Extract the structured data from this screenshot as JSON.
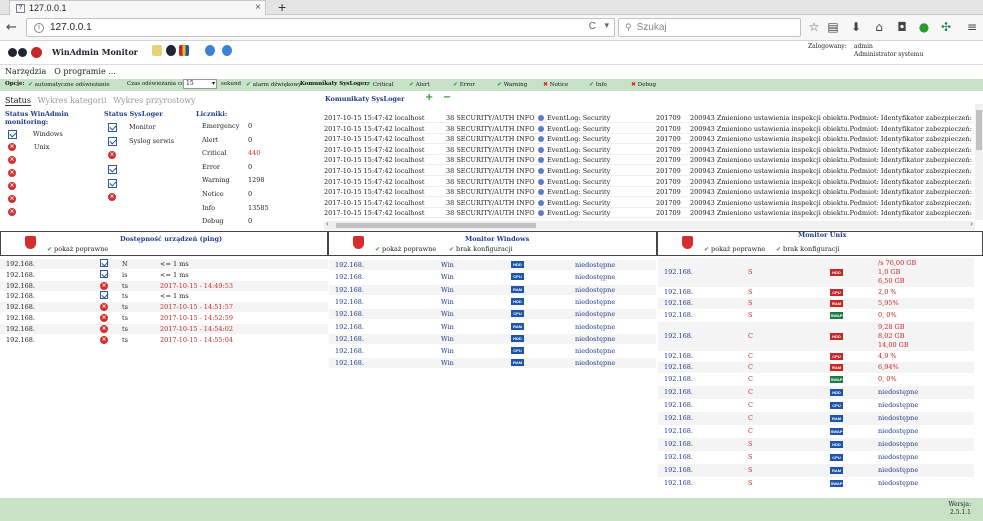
{
  "browser": {
    "tab_title": "127.0.0.1",
    "favicon_label": "?",
    "close_glyph": "×",
    "new_tab_glyph": "+",
    "url": "127.0.0.1",
    "search_placeholder": "Szukaj",
    "reload_glyph": "C",
    "dropdown_glyph": "▾"
  },
  "app": {
    "title": "WinAdmin Monitor",
    "user_label": "Zalogowany:",
    "user_name": "admin",
    "user_role": "Administrator systemu"
  },
  "menu": [
    "Narzędzia",
    "O programie ..."
  ],
  "options": {
    "label": "Opcje:",
    "auto_refresh": "automatyczne odświeżanie",
    "interval_label": "Czas odświeżania co",
    "interval_value": "15",
    "interval_unit": "sekund",
    "sound_alarm": "alarm dźwiękowy",
    "syslog_label": "Komunikaty SysLoger:",
    "levels": [
      {
        "name": "Critical",
        "on": true
      },
      {
        "name": "Alert",
        "on": true
      },
      {
        "name": "Error",
        "on": true
      },
      {
        "name": "Warning",
        "on": true
      },
      {
        "name": "Notice",
        "on": false
      },
      {
        "name": "Info",
        "on": true
      },
      {
        "name": "Debug",
        "on": false
      }
    ]
  },
  "status_tabs": [
    "Status",
    "Wykres kategorii",
    "Wykres przyrostowy"
  ],
  "status_winadmin": {
    "title": "Status WinAdmin monitoring:",
    "items": [
      "Windows",
      "Unix"
    ]
  },
  "status_sysloger": {
    "title": "Status SysLoger",
    "items": [
      "Monitor",
      "Syslog serwis"
    ]
  },
  "counters": {
    "title": "Liczniki:",
    "items": [
      {
        "label": "Emergency",
        "value": "0",
        "red": false
      },
      {
        "label": "Alert",
        "value": "0",
        "red": false
      },
      {
        "label": "Critical",
        "value": "440",
        "red": true
      },
      {
        "label": "Error",
        "value": "0",
        "red": false
      },
      {
        "label": "Warning",
        "value": "1298",
        "red": false
      },
      {
        "label": "Notice",
        "value": "0",
        "red": false
      },
      {
        "label": "Info",
        "value": "13585",
        "red": false
      },
      {
        "label": "Debug",
        "value": "0",
        "red": false
      }
    ]
  },
  "syslog": {
    "title": "Komunikaty SysLoger",
    "add_glyph": "+",
    "remove_glyph": "−",
    "rows": [
      {
        "time": "2017-10-15 15:47:42",
        "host": "localhost",
        "facility": "38 SECURITY/AUTH",
        "level": "INFO",
        "source": "EventLog: Security",
        "code": "201709",
        "msg": "200943 Zmieniono ustawienia inspekcji obiektu.Podmiot: Identyfikator zabezpieczeń: S-1-5-18"
      },
      {
        "time": "2017-10-15 15:47:42",
        "host": "localhost",
        "facility": "38 SECURITY/AUTH",
        "level": "INFO",
        "source": "EventLog: Security",
        "code": "201709",
        "msg": "200943 Zmieniono ustawienia inspekcji obiektu.Podmiot: Identyfikator zabezpieczeń: S-1-5-18"
      },
      {
        "time": "2017-10-15 15:47:42",
        "host": "localhost",
        "facility": "38 SECURITY/AUTH",
        "level": "INFO",
        "source": "EventLog: Security",
        "code": "201709",
        "msg": "200943 Zmieniono ustawienia inspekcji obiektu.Podmiot: Identyfikator zabezpieczeń: S-1-5-18"
      },
      {
        "time": "2017-10-15 15:47:42",
        "host": "localhost",
        "facility": "38 SECURITY/AUTH",
        "level": "INFO",
        "source": "EventLog: Security",
        "code": "201709",
        "msg": "200943 Zmieniono ustawienia inspekcji obiektu.Podmiot: Identyfikator zabezpieczeń: S-1-5-18"
      },
      {
        "time": "2017-10-15 15:47:42",
        "host": "localhost",
        "facility": "38 SECURITY/AUTH",
        "level": "INFO",
        "source": "EventLog: Security",
        "code": "201709",
        "msg": "200943 Zmieniono ustawienia inspekcji obiektu.Podmiot: Identyfikator zabezpieczeń: S-1-5-18"
      },
      {
        "time": "2017-10-15 15:47:42",
        "host": "localhost",
        "facility": "38 SECURITY/AUTH",
        "level": "INFO",
        "source": "EventLog: Security",
        "code": "201709",
        "msg": "200943 Zmieniono ustawienia inspekcji obiektu.Podmiot: Identyfikator zabezpieczeń: S-1-5-18"
      },
      {
        "time": "2017-10-15 15:47:42",
        "host": "localhost",
        "facility": "38 SECURITY/AUTH",
        "level": "INFO",
        "source": "EventLog: Security",
        "code": "201709",
        "msg": "200943 Zmieniono ustawienia inspekcji obiektu.Podmiot: Identyfikator zabezpieczeń: S-1-5-18"
      },
      {
        "time": "2017-10-15 15:47:42",
        "host": "localhost",
        "facility": "38 SECURITY/AUTH",
        "level": "INFO",
        "source": "EventLog: Security",
        "code": "201709",
        "msg": "200943 Zmieniono ustawienia inspekcji obiektu.Podmiot: Identyfikator zabezpieczeń: S-1-5-18"
      },
      {
        "time": "2017-10-15 15:47:42",
        "host": "localhost",
        "facility": "38 SECURITY/AUTH",
        "level": "INFO",
        "source": "EventLog: Security",
        "code": "201709",
        "msg": "200943 Zmieniono ustawienia inspekcji obiektu.Podmiot: Identyfikator zabezpieczeń: S-1-5-18"
      },
      {
        "time": "2017-10-15 15:47:42",
        "host": "localhost",
        "facility": "38 SECURITY/AUTH",
        "level": "INFO",
        "source": "EventLog: Security",
        "code": "201709",
        "msg": "200943 Zmieniono ustawienia inspekcji obiektu.Podmiot: Identyfikator zabezpieczeń: S-1-5-18"
      }
    ]
  },
  "ping_panel": {
    "title": "Dostępność urządzeń (ping)",
    "show_ok": "pokaż poprawne",
    "rows": [
      {
        "ip": "192.168.",
        "ok": true,
        "n": "N",
        "val": "<= 1 ms"
      },
      {
        "ip": "192.168.",
        "ok": true,
        "n": "is",
        "val": "<= 1 ms"
      },
      {
        "ip": "192.168.",
        "ok": false,
        "n": "ts",
        "val": "2017-10-15 - 14:49:53"
      },
      {
        "ip": "192.168.",
        "ok": true,
        "n": "ts",
        "val": "<= 1 ms"
      },
      {
        "ip": "192.168.",
        "ok": false,
        "n": "ts",
        "val": "2017-10-15 - 14:51:57"
      },
      {
        "ip": "192.168.",
        "ok": false,
        "n": "ts",
        "val": "2017-10-15 - 14:52:59"
      },
      {
        "ip": "192.168.",
        "ok": false,
        "n": "ts",
        "val": "2017-10-15 - 14:54:02"
      },
      {
        "ip": "192.168.",
        "ok": false,
        "n": "ts",
        "val": "2017-10-15 - 14:55:04"
      }
    ]
  },
  "windows_panel": {
    "title": "Monitor Windows",
    "show_ok": "pokaż poprawne",
    "no_config": "brak konfiguracji",
    "rows": [
      {
        "ip": "192.168.",
        "os": "Win",
        "res": "HDD",
        "status": "niedostępne"
      },
      {
        "ip": "192.168.",
        "os": "Win",
        "res": "CPU",
        "status": "niedostępne"
      },
      {
        "ip": "192.168.",
        "os": "Win",
        "res": "RAM",
        "status": "niedostępne"
      },
      {
        "ip": "192.168.",
        "os": "Win",
        "res": "HDD",
        "status": "niedostępne"
      },
      {
        "ip": "192.168.",
        "os": "Win",
        "res": "CPU",
        "status": "niedostępne"
      },
      {
        "ip": "192.168.",
        "os": "Win",
        "res": "RAM",
        "status": "niedostępne"
      },
      {
        "ip": "192.168.",
        "os": "Win",
        "res": "HDD",
        "status": "niedostępne"
      },
      {
        "ip": "192.168.",
        "os": "Win",
        "res": "CPU",
        "status": "niedostępne"
      },
      {
        "ip": "192.168.",
        "os": "Win",
        "res": "RAM",
        "status": "niedostępne"
      }
    ]
  },
  "unix_panel": {
    "title": "Monitor Unix",
    "show_ok": "pokaż poprawne",
    "no_config": "brak konfiguracji",
    "rows": [
      {
        "ip": "192.168.",
        "os": "S",
        "res": "HDD",
        "kind": "red",
        "lines": [
          "/s        76,00 GB",
          "1,0   GB",
          "6,50 GB"
        ],
        "h": 2.8
      },
      {
        "ip": "192.168.",
        "os": "S",
        "res": "CPU",
        "kind": "red",
        "lines": [
          "2,0  %"
        ],
        "h": 1
      },
      {
        "ip": "192.168.",
        "os": "S",
        "res": "RAM",
        "kind": "red",
        "lines": [
          "5,95%"
        ],
        "h": 1
      },
      {
        "ip": "192.168.",
        "os": "S",
        "res": "SWAP",
        "kind": "grn",
        "lines": [
          "0,  0%"
        ],
        "h": 1.2
      },
      {
        "ip": "192.168.",
        "os": "C",
        "res": "HDD",
        "kind": "red",
        "lines": [
          "9,28 GB",
          "8,02 GB",
          "14,00 GB"
        ],
        "h": 2.8
      },
      {
        "ip": "192.168.",
        "os": "C",
        "res": "CPU",
        "kind": "red",
        "lines": [
          "4,9  %"
        ],
        "h": 1
      },
      {
        "ip": "192.168.",
        "os": "C",
        "res": "RAM",
        "kind": "red",
        "lines": [
          "6,94%"
        ],
        "h": 1
      },
      {
        "ip": "192.168.",
        "os": "C",
        "res": "SWAP",
        "kind": "grn",
        "lines": [
          "0,  0%"
        ],
        "h": 1.2
      },
      {
        "ip": "192.168.",
        "os": "C",
        "res": "HDD",
        "kind": "blu",
        "lines": [
          "niedostępne"
        ],
        "h": 1.2
      },
      {
        "ip": "192.168.",
        "os": "C",
        "res": "CPU",
        "kind": "blu",
        "lines": [
          "niedostępne"
        ],
        "h": 1.2
      },
      {
        "ip": "192.168.",
        "os": "C",
        "res": "RAM",
        "kind": "blu",
        "lines": [
          "niedostępne"
        ],
        "h": 1.2
      },
      {
        "ip": "192.168.",
        "os": "C",
        "res": "SWAP",
        "kind": "blu",
        "lines": [
          "niedostępne"
        ],
        "h": 1.2
      },
      {
        "ip": "192.168.",
        "os": "S",
        "res": "HDD",
        "kind": "blu",
        "lines": [
          "niedostępne"
        ],
        "h": 1.2
      },
      {
        "ip": "192.168.",
        "os": "S",
        "res": "CPU",
        "kind": "blu",
        "lines": [
          "niedostępne"
        ],
        "h": 1.2
      },
      {
        "ip": "192.168.",
        "os": "S",
        "res": "RAM",
        "kind": "blu",
        "lines": [
          "niedostępne"
        ],
        "h": 1.2
      },
      {
        "ip": "192.168.",
        "os": "S",
        "res": "SWAP",
        "kind": "blu",
        "lines": [
          "niedostępne"
        ],
        "h": 1.2
      }
    ]
  },
  "version": {
    "label": "Wersja:",
    "number": "2.5.1.1"
  },
  "colors": {
    "accent_green": "#c8e2c8",
    "alert_red": "#d32f2f",
    "link_blue": "#1e3a8a"
  }
}
